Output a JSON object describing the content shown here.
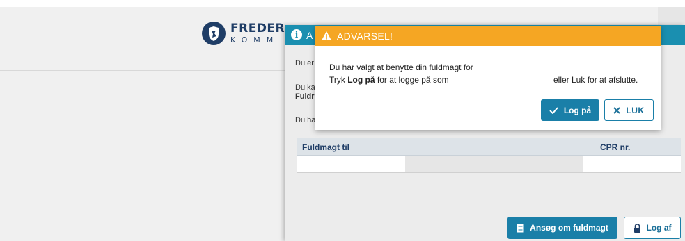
{
  "logo": {
    "name": "FREDER",
    "sub": "KOMM"
  },
  "info_dialog": {
    "title_fragment": "A",
    "text_fragments": [
      "Du er",
      "Du ka",
      "Fuldr",
      "Du ha"
    ],
    "table": {
      "headers": [
        "Fuldmagt til",
        "CPR nr."
      ]
    },
    "buttons": {
      "apply": "Ansøg om fuldmagt",
      "logout": "Log af"
    }
  },
  "warning_dialog": {
    "title": "ADVARSEL!",
    "line1": "Du har valgt at benytte din fuldmagt for",
    "line2_pre": "Tryk ",
    "line2_bold": "Log på",
    "line2_mid": " for at logge på som",
    "line2_post": "eller Luk for at afslutte.",
    "buttons": {
      "login": "Log på",
      "close": "LUK"
    }
  },
  "colors": {
    "primary": "#1a7fa8",
    "warning": "#f5a623",
    "brand": "#1f3d66"
  },
  "icons": [
    "info-icon",
    "warning-icon",
    "check-icon",
    "close-icon",
    "document-icon",
    "lock-icon",
    "coat-of-arms-icon"
  ]
}
